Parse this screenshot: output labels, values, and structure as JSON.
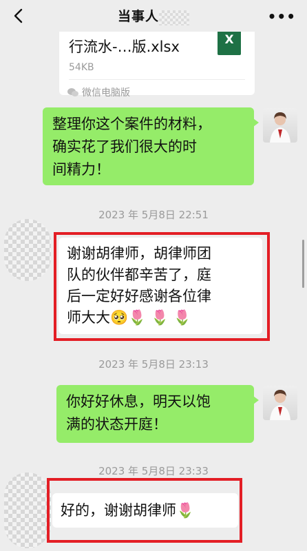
{
  "header": {
    "title": "当事人",
    "more": "•••"
  },
  "file": {
    "name": "行流水-…版.xlsx",
    "size": "54KB",
    "source": "微信电脑版",
    "icon_letter": "X"
  },
  "messages": {
    "m1": [
      "整理你这个案件的材料，",
      "确实花了我们很大的时",
      "间精力！"
    ],
    "t1": "2023 年 5月8日 22:51",
    "m2": [
      "谢谢胡律师，胡律师团",
      "队的伙伴都辛苦了，庭",
      "后一定好好感谢各位律",
      "师大大"
    ],
    "m2_emoji": "🥺",
    "m2_flowers": "🌷 🌷 🌷",
    "t2": "2023 年 5月8日 23:13",
    "m3": [
      "你好好休息，明天以饱",
      "满的状态开庭！"
    ],
    "t3": "2023 年 5月8日 23:33",
    "m4": "好的，谢谢胡律师",
    "m4_flower": "🌷"
  },
  "colors": {
    "outgoing_bubble": "#95ec69",
    "incoming_bubble": "#ffffff",
    "highlight": "#e31e25",
    "background": "#ededed"
  },
  "icons": {
    "back": "chevron-left-icon",
    "more": "more-dots-icon",
    "file": "excel-file-icon",
    "source": "wechat-icon"
  }
}
